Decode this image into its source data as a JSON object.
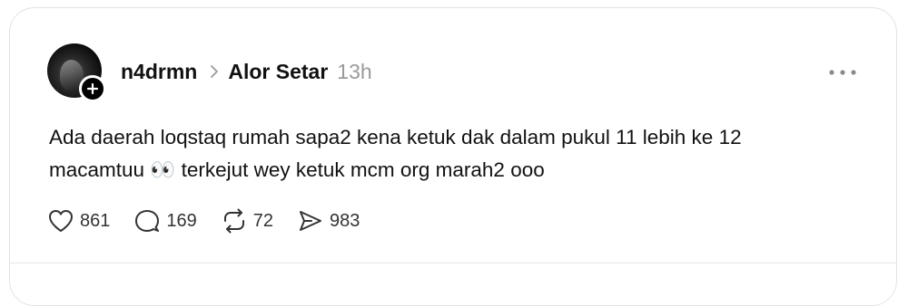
{
  "post": {
    "username": "n4drmn",
    "location": "Alor Setar",
    "time": "13h",
    "text_line1": "Ada daerah loqstaq rumah sapa2 kena ketuk dak dalam pukul 11 lebih ke 12",
    "text_line2_a": "macamtuu ",
    "text_emoji": "👀",
    "text_line2_b": " terkejut wey ketuk mcm org marah2 ooo"
  },
  "actions": {
    "likes": "861",
    "replies": "169",
    "reposts": "72",
    "shares": "983"
  },
  "icons": {
    "avatar": "avatar-photo",
    "follow": "plus-icon",
    "separator": "chevron-right-icon",
    "menu": "more-horizontal-icon",
    "like": "heart-icon",
    "reply": "comment-icon",
    "repost": "repost-icon",
    "share": "send-icon"
  }
}
